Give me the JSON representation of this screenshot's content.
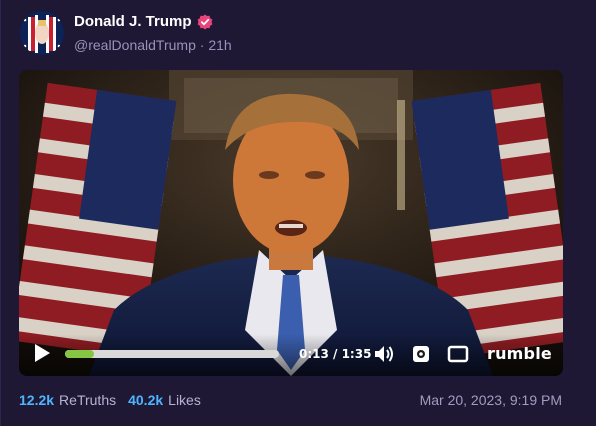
{
  "author": {
    "display_name": "Donald J. Trump",
    "handle": "@realDonaldTrump",
    "separator": "·",
    "age": "21h",
    "verified_icon": "verified-badge-icon",
    "verified_color": "#e8457a"
  },
  "video": {
    "time": "0:13 / 1:35",
    "progress": 0.137,
    "brand": "rumble",
    "progress_color": "#85c742"
  },
  "stats": {
    "retruths_count": "12.2k",
    "retruths_label": "ReTruths",
    "likes_count": "40.2k",
    "likes_label": "Likes"
  },
  "timestamp": "Mar 20, 2023, 9:19 PM",
  "colors": {
    "background": "#1e1835",
    "count_accent": "#4db6ff",
    "muted_text": "#9a92b8"
  }
}
